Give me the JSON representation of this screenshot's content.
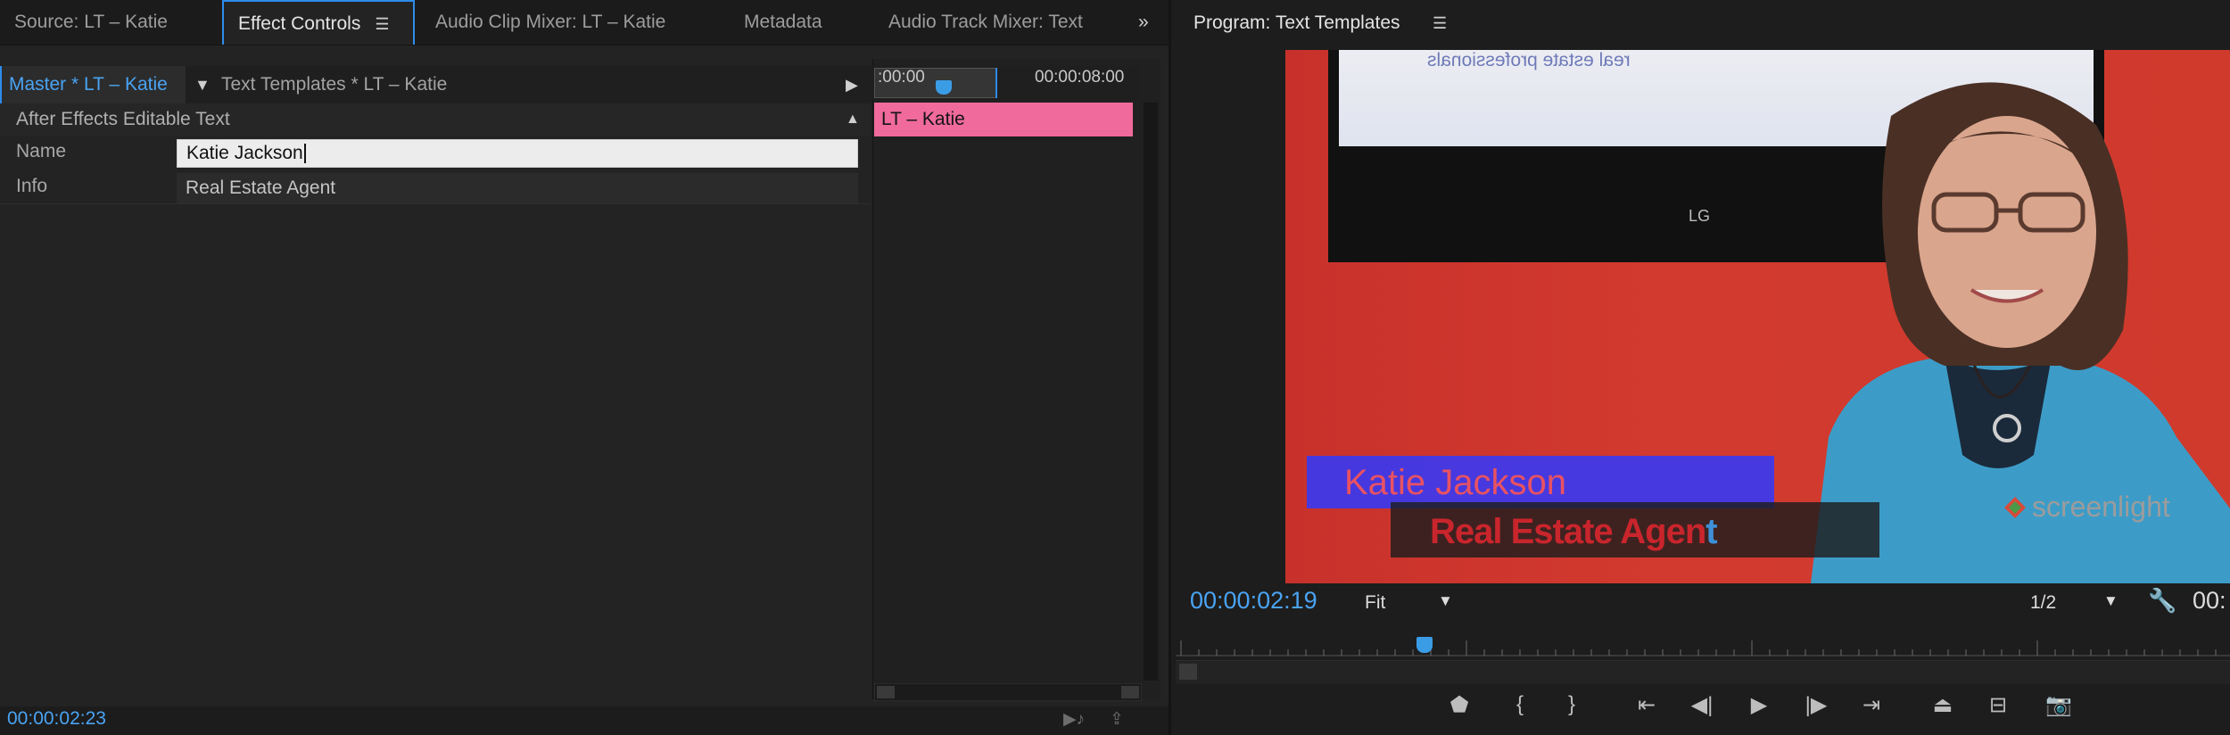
{
  "left_tabs": [
    {
      "label": "Source: LT – Katie"
    },
    {
      "label": "Effect Controls"
    },
    {
      "label": "Audio Clip Mixer: LT – Katie"
    },
    {
      "label": "Metadata"
    },
    {
      "label": "Audio Track Mixer: Text"
    }
  ],
  "effect_controls": {
    "master_clip": "Master * LT – Katie",
    "sequence_clip": "Text Templates * LT – Katie",
    "section_title": "After Effects Editable Text",
    "params": [
      {
        "label": "Name",
        "value": "Katie Jackson"
      },
      {
        "label": "Info",
        "value": "Real Estate Agent"
      }
    ],
    "timeline_start": ":00:00",
    "timeline_end": "00:00:08:00",
    "clip_label": "LT – Katie",
    "clip_color": "#f06a9b",
    "timecode": "00:00:02:23"
  },
  "program": {
    "title": "Program: Text Templates",
    "timecode": "00:00:02:19",
    "zoom": "Fit",
    "resolution": "1/2",
    "duration_partial": "00:",
    "lower_third": {
      "name": "Katie Jackson",
      "info_main": "Real Estate Agen",
      "info_tail": "t"
    },
    "tv_text": "real estate professionals",
    "tv_logo": "LG",
    "watermark": "screenlight",
    "accent": "#2d8ceb"
  },
  "transport_icons": [
    "add-marker-icon",
    "mark-in-icon",
    "mark-out-icon",
    "go-to-in-icon",
    "step-back-icon",
    "play-icon",
    "step-forward-icon",
    "go-to-out-icon",
    "lift-icon",
    "extract-icon",
    "export-frame-icon"
  ]
}
